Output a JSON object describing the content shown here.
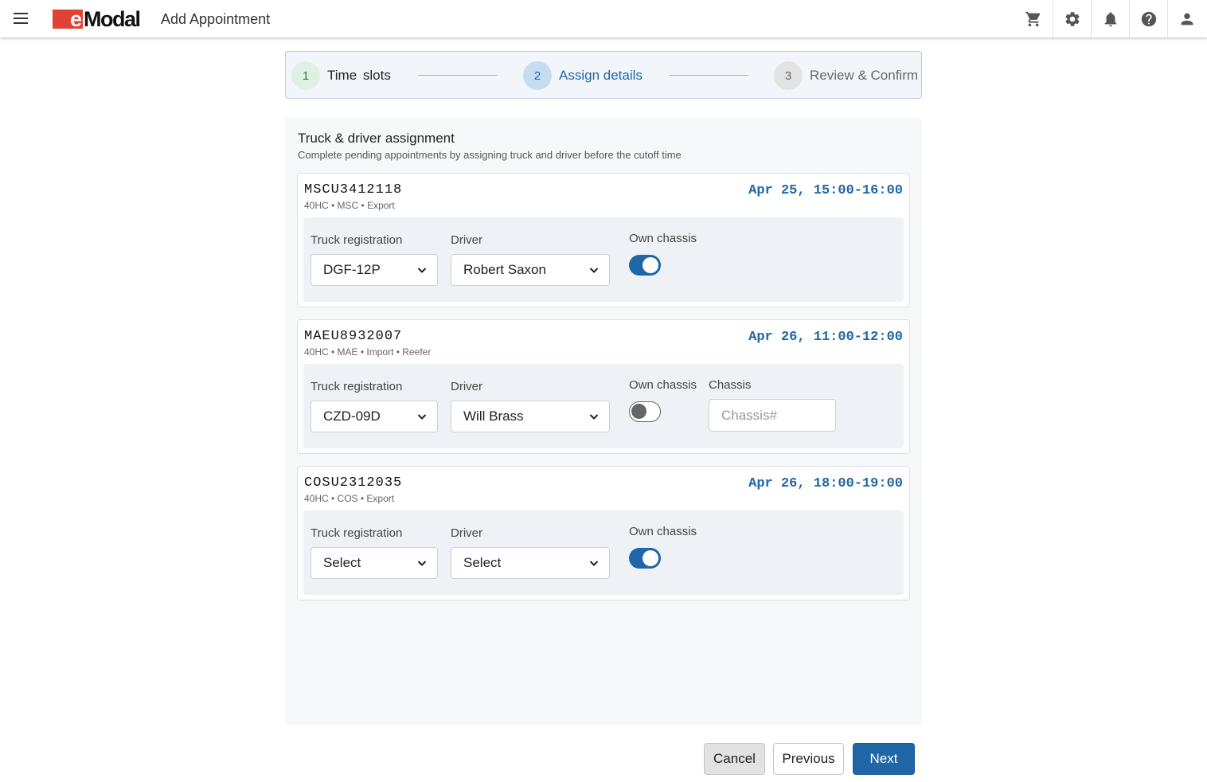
{
  "header": {
    "logo_e": "e",
    "logo_rest": "Modal",
    "title": "Add Appointment",
    "icons": [
      "cart-icon",
      "gear-icon",
      "bell-icon",
      "help-icon",
      "user-icon"
    ]
  },
  "stepper": {
    "steps": [
      {
        "number": "1",
        "label": "Time slots",
        "state": "done"
      },
      {
        "number": "2",
        "label": "Assign details",
        "state": "active"
      },
      {
        "number": "3",
        "label": "Review & Confirm",
        "state": "pending"
      }
    ]
  },
  "panel": {
    "title": "Truck & driver assignment",
    "subtitle": "Complete pending appointments by assigning truck and driver before the cutoff time"
  },
  "labels": {
    "truck": "Truck registration",
    "driver": "Driver",
    "own_chassis": "Own chassis",
    "chassis": "Chassis",
    "chassis_placeholder": "Chassis#"
  },
  "containers": [
    {
      "id": "MSCU3412118",
      "meta": "40HC • MSC • Export",
      "slot": "Apr 25, 15:00-16:00",
      "truck": "DGF-12P",
      "driver": "Robert Saxon",
      "own_chassis": true
    },
    {
      "id": "MAEU8932007",
      "meta": "40HC • MAE • Import • Reefer",
      "slot": "Apr 26, 11:00-12:00",
      "truck": "CZD-09D",
      "driver": "Will Brass",
      "own_chassis": false
    },
    {
      "id": "COSU2312035",
      "meta": "40HC • COS • Export",
      "slot": "Apr 26, 18:00-19:00",
      "truck": "Select",
      "driver": "Select",
      "own_chassis": true
    }
  ],
  "footer": {
    "cancel": "Cancel",
    "previous": "Previous",
    "next": "Next"
  },
  "colors": {
    "brand_red": "#e04335",
    "accent_blue": "#1f66a8"
  }
}
